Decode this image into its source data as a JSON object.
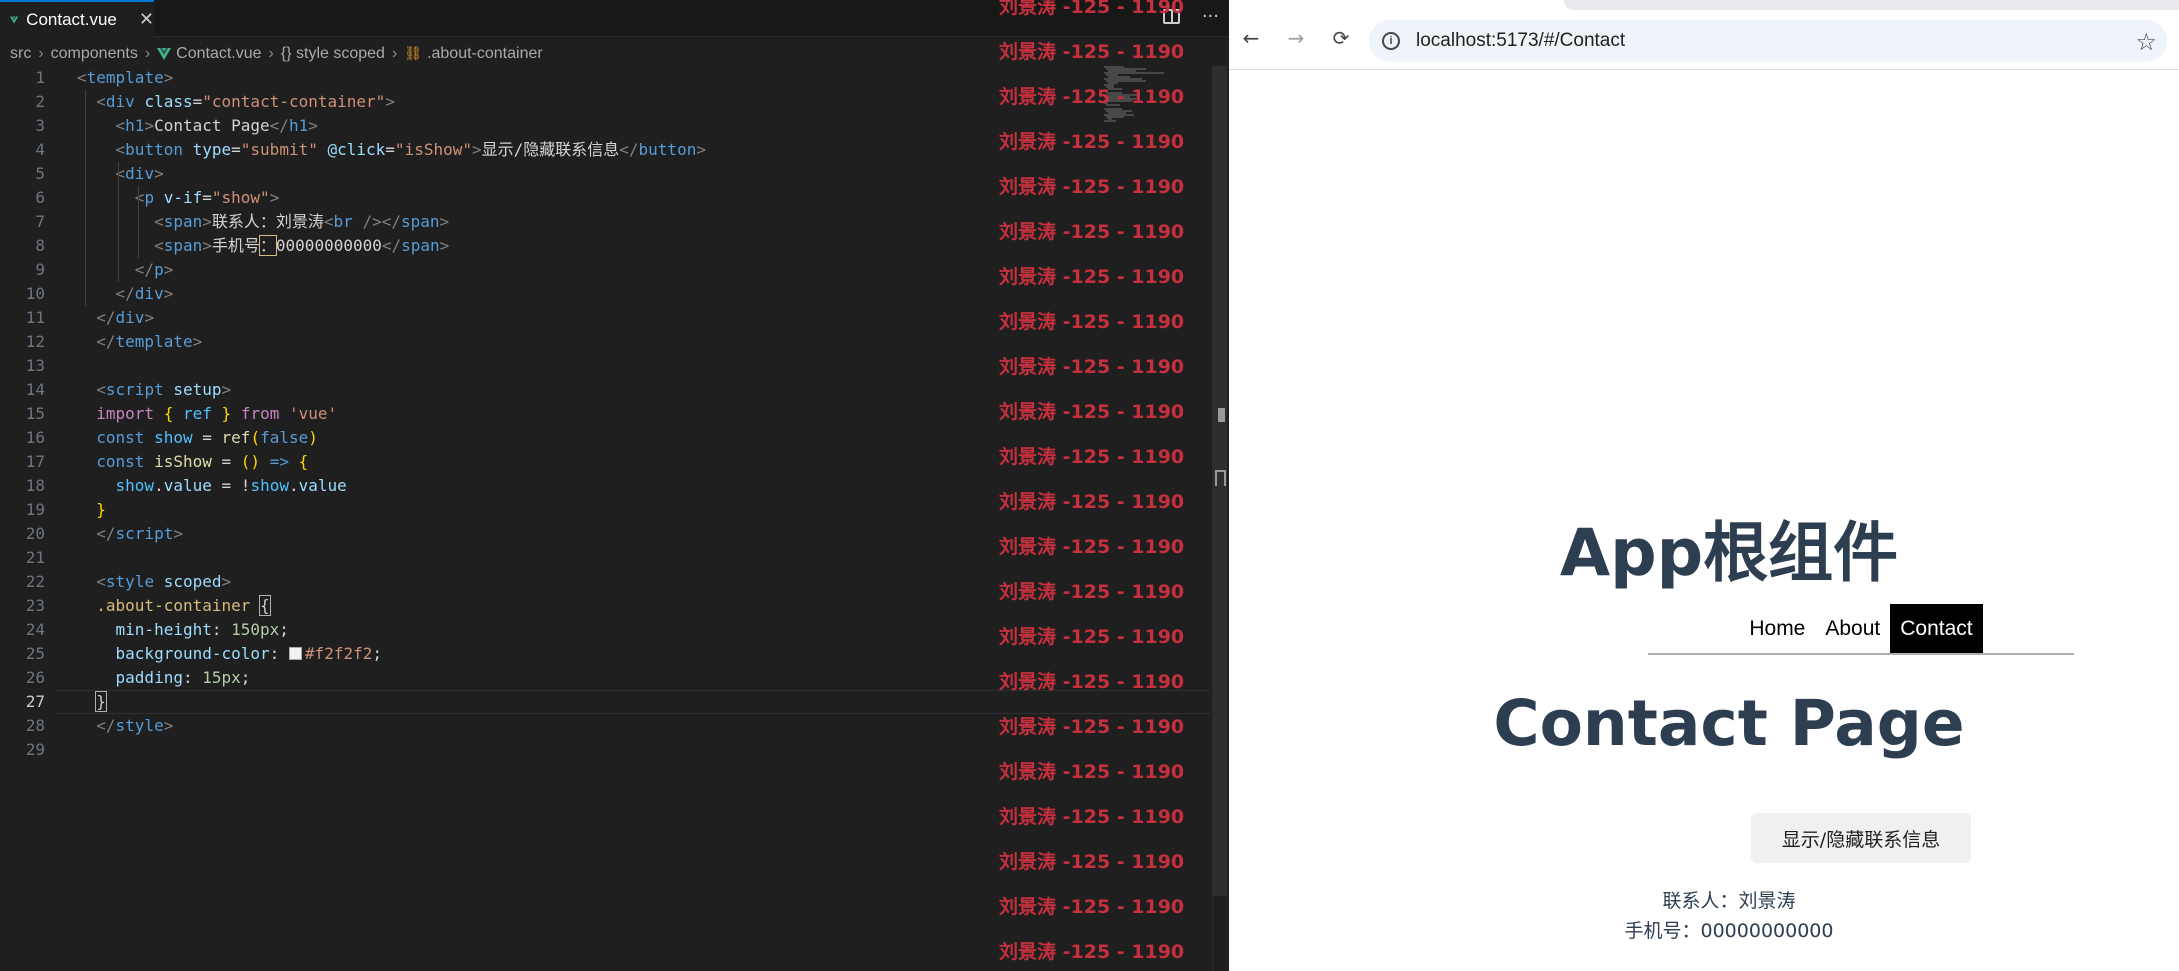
{
  "editor": {
    "tab": {
      "label": "Contact.vue",
      "close": "✕"
    },
    "actions": {
      "more": "···"
    },
    "breadcrumb": [
      "src",
      "components",
      "Contact.vue",
      "{} style scoped",
      ".about-container"
    ],
    "breadcrumb_sep": "›",
    "line_numbers": [
      "1",
      "2",
      "3",
      "4",
      "5",
      "6",
      "7",
      "8",
      "9",
      "10",
      "11",
      "12",
      "13",
      "14",
      "15",
      "16",
      "17",
      "18",
      "19",
      "20",
      "21",
      "22",
      "23",
      "24",
      "25",
      "26",
      "27",
      "28",
      "29"
    ],
    "active_line": "27",
    "code": [
      [
        [
          "t-punc",
          "<"
        ],
        [
          "t-tag",
          "template"
        ],
        [
          "t-punc",
          ">"
        ]
      ],
      [
        [
          "t-text",
          "  "
        ],
        [
          "t-punc",
          "<"
        ],
        [
          "t-tag",
          "div"
        ],
        [
          "t-text",
          " "
        ],
        [
          "t-attr",
          "class"
        ],
        [
          "t-text",
          "="
        ],
        [
          "t-str",
          "\"contact-container\""
        ],
        [
          "t-punc",
          ">"
        ]
      ],
      [
        [
          "t-text",
          "    "
        ],
        [
          "t-punc",
          "<"
        ],
        [
          "t-tag",
          "h1"
        ],
        [
          "t-punc",
          ">"
        ],
        [
          "t-text",
          "Contact Page"
        ],
        [
          "t-punc",
          "</"
        ],
        [
          "t-tag",
          "h1"
        ],
        [
          "t-punc",
          ">"
        ]
      ],
      [
        [
          "t-text",
          "    "
        ],
        [
          "t-punc",
          "<"
        ],
        [
          "t-tag",
          "button"
        ],
        [
          "t-text",
          " "
        ],
        [
          "t-attr",
          "type"
        ],
        [
          "t-text",
          "="
        ],
        [
          "t-str",
          "\"submit\""
        ],
        [
          "t-text",
          " "
        ],
        [
          "t-attr",
          "@click"
        ],
        [
          "t-text",
          "="
        ],
        [
          "t-str",
          "\"isShow\""
        ],
        [
          "t-punc",
          ">"
        ],
        [
          "t-text",
          "显示/隐藏联系信息"
        ],
        [
          "t-punc",
          "</"
        ],
        [
          "t-tag",
          "button"
        ],
        [
          "t-punc",
          ">"
        ]
      ],
      [
        [
          "t-text",
          "    "
        ],
        [
          "t-punc",
          "<"
        ],
        [
          "t-tag",
          "div"
        ],
        [
          "t-punc",
          ">"
        ]
      ],
      [
        [
          "t-text",
          "      "
        ],
        [
          "t-punc",
          "<"
        ],
        [
          "t-tag",
          "p"
        ],
        [
          "t-text",
          " "
        ],
        [
          "t-attr",
          "v-if"
        ],
        [
          "t-text",
          "="
        ],
        [
          "t-str",
          "\"show\""
        ],
        [
          "t-punc",
          ">"
        ]
      ],
      [
        [
          "t-text",
          "        "
        ],
        [
          "t-punc",
          "<"
        ],
        [
          "t-tag",
          "span"
        ],
        [
          "t-punc",
          ">"
        ],
        [
          "t-text",
          "联系人：刘景涛"
        ],
        [
          "t-punc",
          "<"
        ],
        [
          "t-tag",
          "br"
        ],
        [
          "t-text",
          " "
        ],
        [
          "t-punc",
          "/>"
        ],
        [
          "t-punc",
          "</"
        ],
        [
          "t-tag",
          "span"
        ],
        [
          "t-punc",
          ">"
        ]
      ],
      [
        [
          "t-text",
          "        "
        ],
        [
          "t-punc",
          "<"
        ],
        [
          "t-tag",
          "span"
        ],
        [
          "t-punc",
          ">"
        ],
        [
          "t-text",
          "手机号"
        ],
        [
          "cursor-hl",
          "："
        ],
        [
          "t-text",
          "00000000000"
        ],
        [
          "t-punc",
          "</"
        ],
        [
          "t-tag",
          "span"
        ],
        [
          "t-punc",
          ">"
        ]
      ],
      [
        [
          "t-text",
          "      "
        ],
        [
          "t-punc",
          "</"
        ],
        [
          "t-tag",
          "p"
        ],
        [
          "t-punc",
          ">"
        ]
      ],
      [
        [
          "t-text",
          "    "
        ],
        [
          "t-punc",
          "</"
        ],
        [
          "t-tag",
          "div"
        ],
        [
          "t-punc",
          ">"
        ]
      ],
      [
        [
          "t-text",
          "  "
        ],
        [
          "t-punc",
          "</"
        ],
        [
          "t-tag",
          "div"
        ],
        [
          "t-punc",
          ">"
        ]
      ],
      [
        [
          "t-text",
          "  "
        ],
        [
          "t-punc",
          "</"
        ],
        [
          "t-tag",
          "template"
        ],
        [
          "t-punc",
          ">"
        ]
      ],
      [],
      [
        [
          "t-text",
          "  "
        ],
        [
          "t-punc",
          "<"
        ],
        [
          "t-tag",
          "script"
        ],
        [
          "t-text",
          " "
        ],
        [
          "t-attr",
          "setup"
        ],
        [
          "t-punc",
          ">"
        ]
      ],
      [
        [
          "t-text",
          "  "
        ],
        [
          "t-kw",
          "import"
        ],
        [
          "t-text",
          " "
        ],
        [
          "t-brace",
          "{"
        ],
        [
          "t-text",
          " "
        ],
        [
          "t-var",
          "ref"
        ],
        [
          "t-text",
          " "
        ],
        [
          "t-brace",
          "}"
        ],
        [
          "t-text",
          " "
        ],
        [
          "t-kw",
          "from"
        ],
        [
          "t-text",
          " "
        ],
        [
          "t-str",
          "'vue'"
        ]
      ],
      [
        [
          "t-text",
          "  "
        ],
        [
          "t-decl",
          "const"
        ],
        [
          "t-text",
          " "
        ],
        [
          "t-var",
          "show"
        ],
        [
          "t-text",
          " "
        ],
        [
          "t-op",
          "="
        ],
        [
          "t-text",
          " "
        ],
        [
          "t-fn",
          "ref"
        ],
        [
          "t-brace",
          "("
        ],
        [
          "t-bool",
          "false"
        ],
        [
          "t-brace",
          ")"
        ]
      ],
      [
        [
          "t-text",
          "  "
        ],
        [
          "t-decl",
          "const"
        ],
        [
          "t-text",
          " "
        ],
        [
          "t-fn",
          "isShow"
        ],
        [
          "t-text",
          " "
        ],
        [
          "t-op",
          "="
        ],
        [
          "t-text",
          " "
        ],
        [
          "t-brace",
          "()"
        ],
        [
          "t-text",
          " "
        ],
        [
          "t-decl",
          "=>"
        ],
        [
          "t-text",
          " "
        ],
        [
          "t-brace",
          "{"
        ]
      ],
      [
        [
          "t-text",
          "    "
        ],
        [
          "t-var",
          "show"
        ],
        [
          "t-op",
          "."
        ],
        [
          "t-attr",
          "value"
        ],
        [
          "t-text",
          " "
        ],
        [
          "t-op",
          "="
        ],
        [
          "t-text",
          " "
        ],
        [
          "t-op",
          "!"
        ],
        [
          "t-var",
          "show"
        ],
        [
          "t-op",
          "."
        ],
        [
          "t-attr",
          "value"
        ]
      ],
      [
        [
          "t-text",
          "  "
        ],
        [
          "t-brace",
          "}"
        ]
      ],
      [
        [
          "t-text",
          "  "
        ],
        [
          "t-punc",
          "</"
        ],
        [
          "t-tag",
          "script"
        ],
        [
          "t-punc",
          ">"
        ]
      ],
      [],
      [
        [
          "t-text",
          "  "
        ],
        [
          "t-punc",
          "<"
        ],
        [
          "t-tag",
          "style"
        ],
        [
          "t-text",
          " "
        ],
        [
          "t-attr",
          "scoped"
        ],
        [
          "t-punc",
          ">"
        ]
      ],
      [
        [
          "t-text",
          "  "
        ],
        [
          "t-sel",
          ".about-container"
        ],
        [
          "t-text",
          " "
        ],
        [
          "bracket-box",
          "{"
        ]
      ],
      [
        [
          "t-text",
          "    "
        ],
        [
          "t-prop",
          "min-height"
        ],
        [
          "t-text",
          ": "
        ],
        [
          "t-num",
          "150px"
        ],
        [
          "t-text",
          ";"
        ]
      ],
      [
        [
          "t-text",
          "    "
        ],
        [
          "t-prop",
          "background-color"
        ],
        [
          "t-text",
          ": "
        ],
        [
          "swatch",
          ""
        ],
        [
          "t-str",
          "#f2f2f2"
        ],
        [
          "t-text",
          ";"
        ]
      ],
      [
        [
          "t-text",
          "    "
        ],
        [
          "t-prop",
          "padding"
        ],
        [
          "t-text",
          ": "
        ],
        [
          "t-num",
          "15px"
        ],
        [
          "t-text",
          ";"
        ]
      ],
      [
        [
          "t-text",
          "  "
        ],
        [
          "bracket-box",
          "}"
        ]
      ],
      [
        [
          "t-text",
          "  "
        ],
        [
          "t-punc",
          "</"
        ],
        [
          "t-tag",
          "style"
        ],
        [
          "t-punc",
          ">"
        ]
      ],
      []
    ],
    "watermark": "刘景涛 -125 - 1190",
    "watermark_top_partial": "刘景涛 -125 - 1190"
  },
  "browser": {
    "back": "←",
    "forward": "→",
    "reload": "⟳",
    "info": "i",
    "url": "localhost:5173/#/Contact",
    "bookmark": "☆"
  },
  "page": {
    "app_title": "App根组件",
    "nav": [
      "Home",
      "About",
      "Contact"
    ],
    "active_nav": "Contact",
    "contact_title": "Contact Page",
    "toggle_button": "显示/隐藏联系信息",
    "contact_name": "联系人：刘景涛",
    "contact_phone": "手机号：00000000000"
  }
}
